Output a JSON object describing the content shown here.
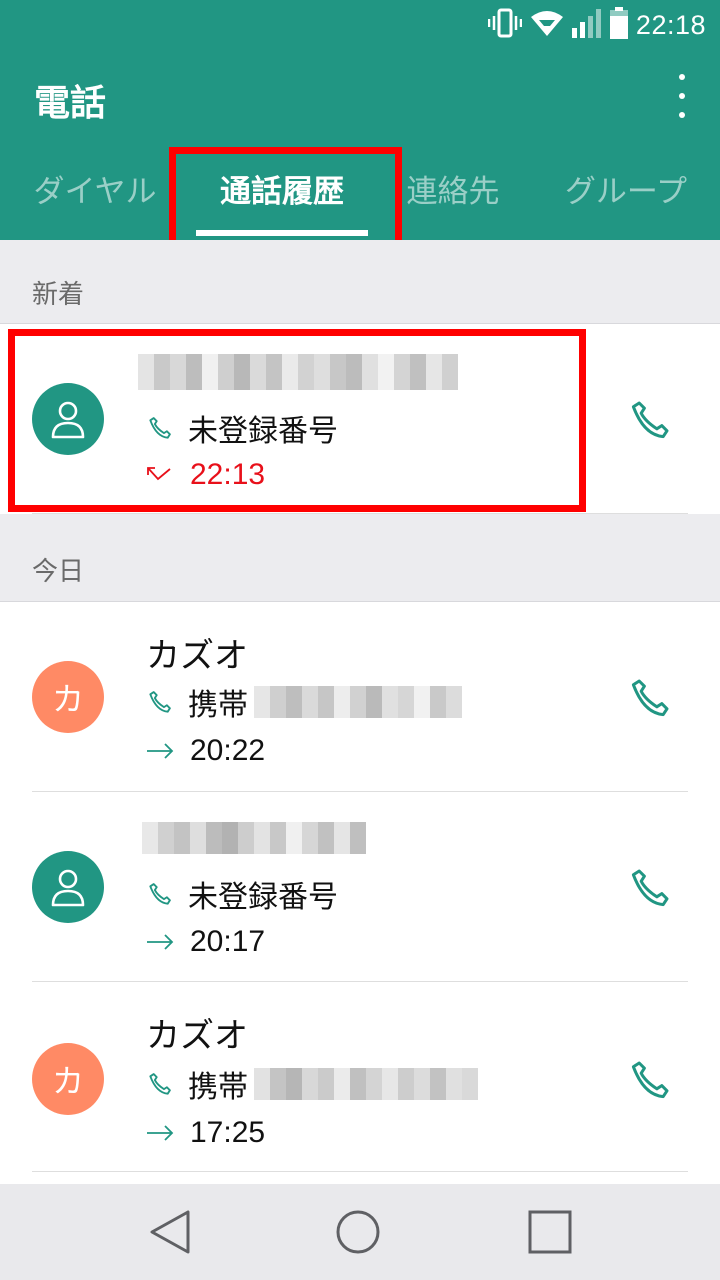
{
  "status_bar": {
    "time": "22:18",
    "icons": [
      "vibrate-icon",
      "wifi-icon",
      "signal-icon",
      "battery-icon"
    ]
  },
  "app_bar": {
    "title": "電話",
    "more_icon": "more-vert-icon"
  },
  "tabs": [
    {
      "label": "ダイヤル",
      "active": false
    },
    {
      "label": "通話履歴",
      "active": true
    },
    {
      "label": "連絡先",
      "active": false
    },
    {
      "label": "グループ",
      "active": false
    }
  ],
  "sections": {
    "new": {
      "label": "新着"
    },
    "today": {
      "label": "今日"
    }
  },
  "calls": [
    {
      "name": "",
      "avatar": "person-icon",
      "type_label": "未登録番号",
      "call_direction": "missed-call-icon",
      "time": "22:13",
      "time_color": "#e8101a"
    },
    {
      "name": "カズオ",
      "avatar": "カ",
      "type_label": "携帯",
      "call_direction": "outgoing-call-icon",
      "time": "20:22",
      "time_color": "#111111"
    },
    {
      "name": "",
      "avatar": "person-icon",
      "type_label": "未登録番号",
      "call_direction": "outgoing-call-icon",
      "time": "20:17",
      "time_color": "#111111"
    },
    {
      "name": "カズオ",
      "avatar": "カ",
      "type_label": "携帯",
      "call_direction": "outgoing-call-icon",
      "time": "17:25",
      "time_color": "#111111"
    }
  ],
  "nav_bar": {
    "icons": [
      "back-icon",
      "home-icon",
      "recents-icon"
    ]
  },
  "colors": {
    "primary": "#219683",
    "highlight": "#ff0000",
    "missed": "#e8101a",
    "avatar_orange": "#ff8a65"
  }
}
